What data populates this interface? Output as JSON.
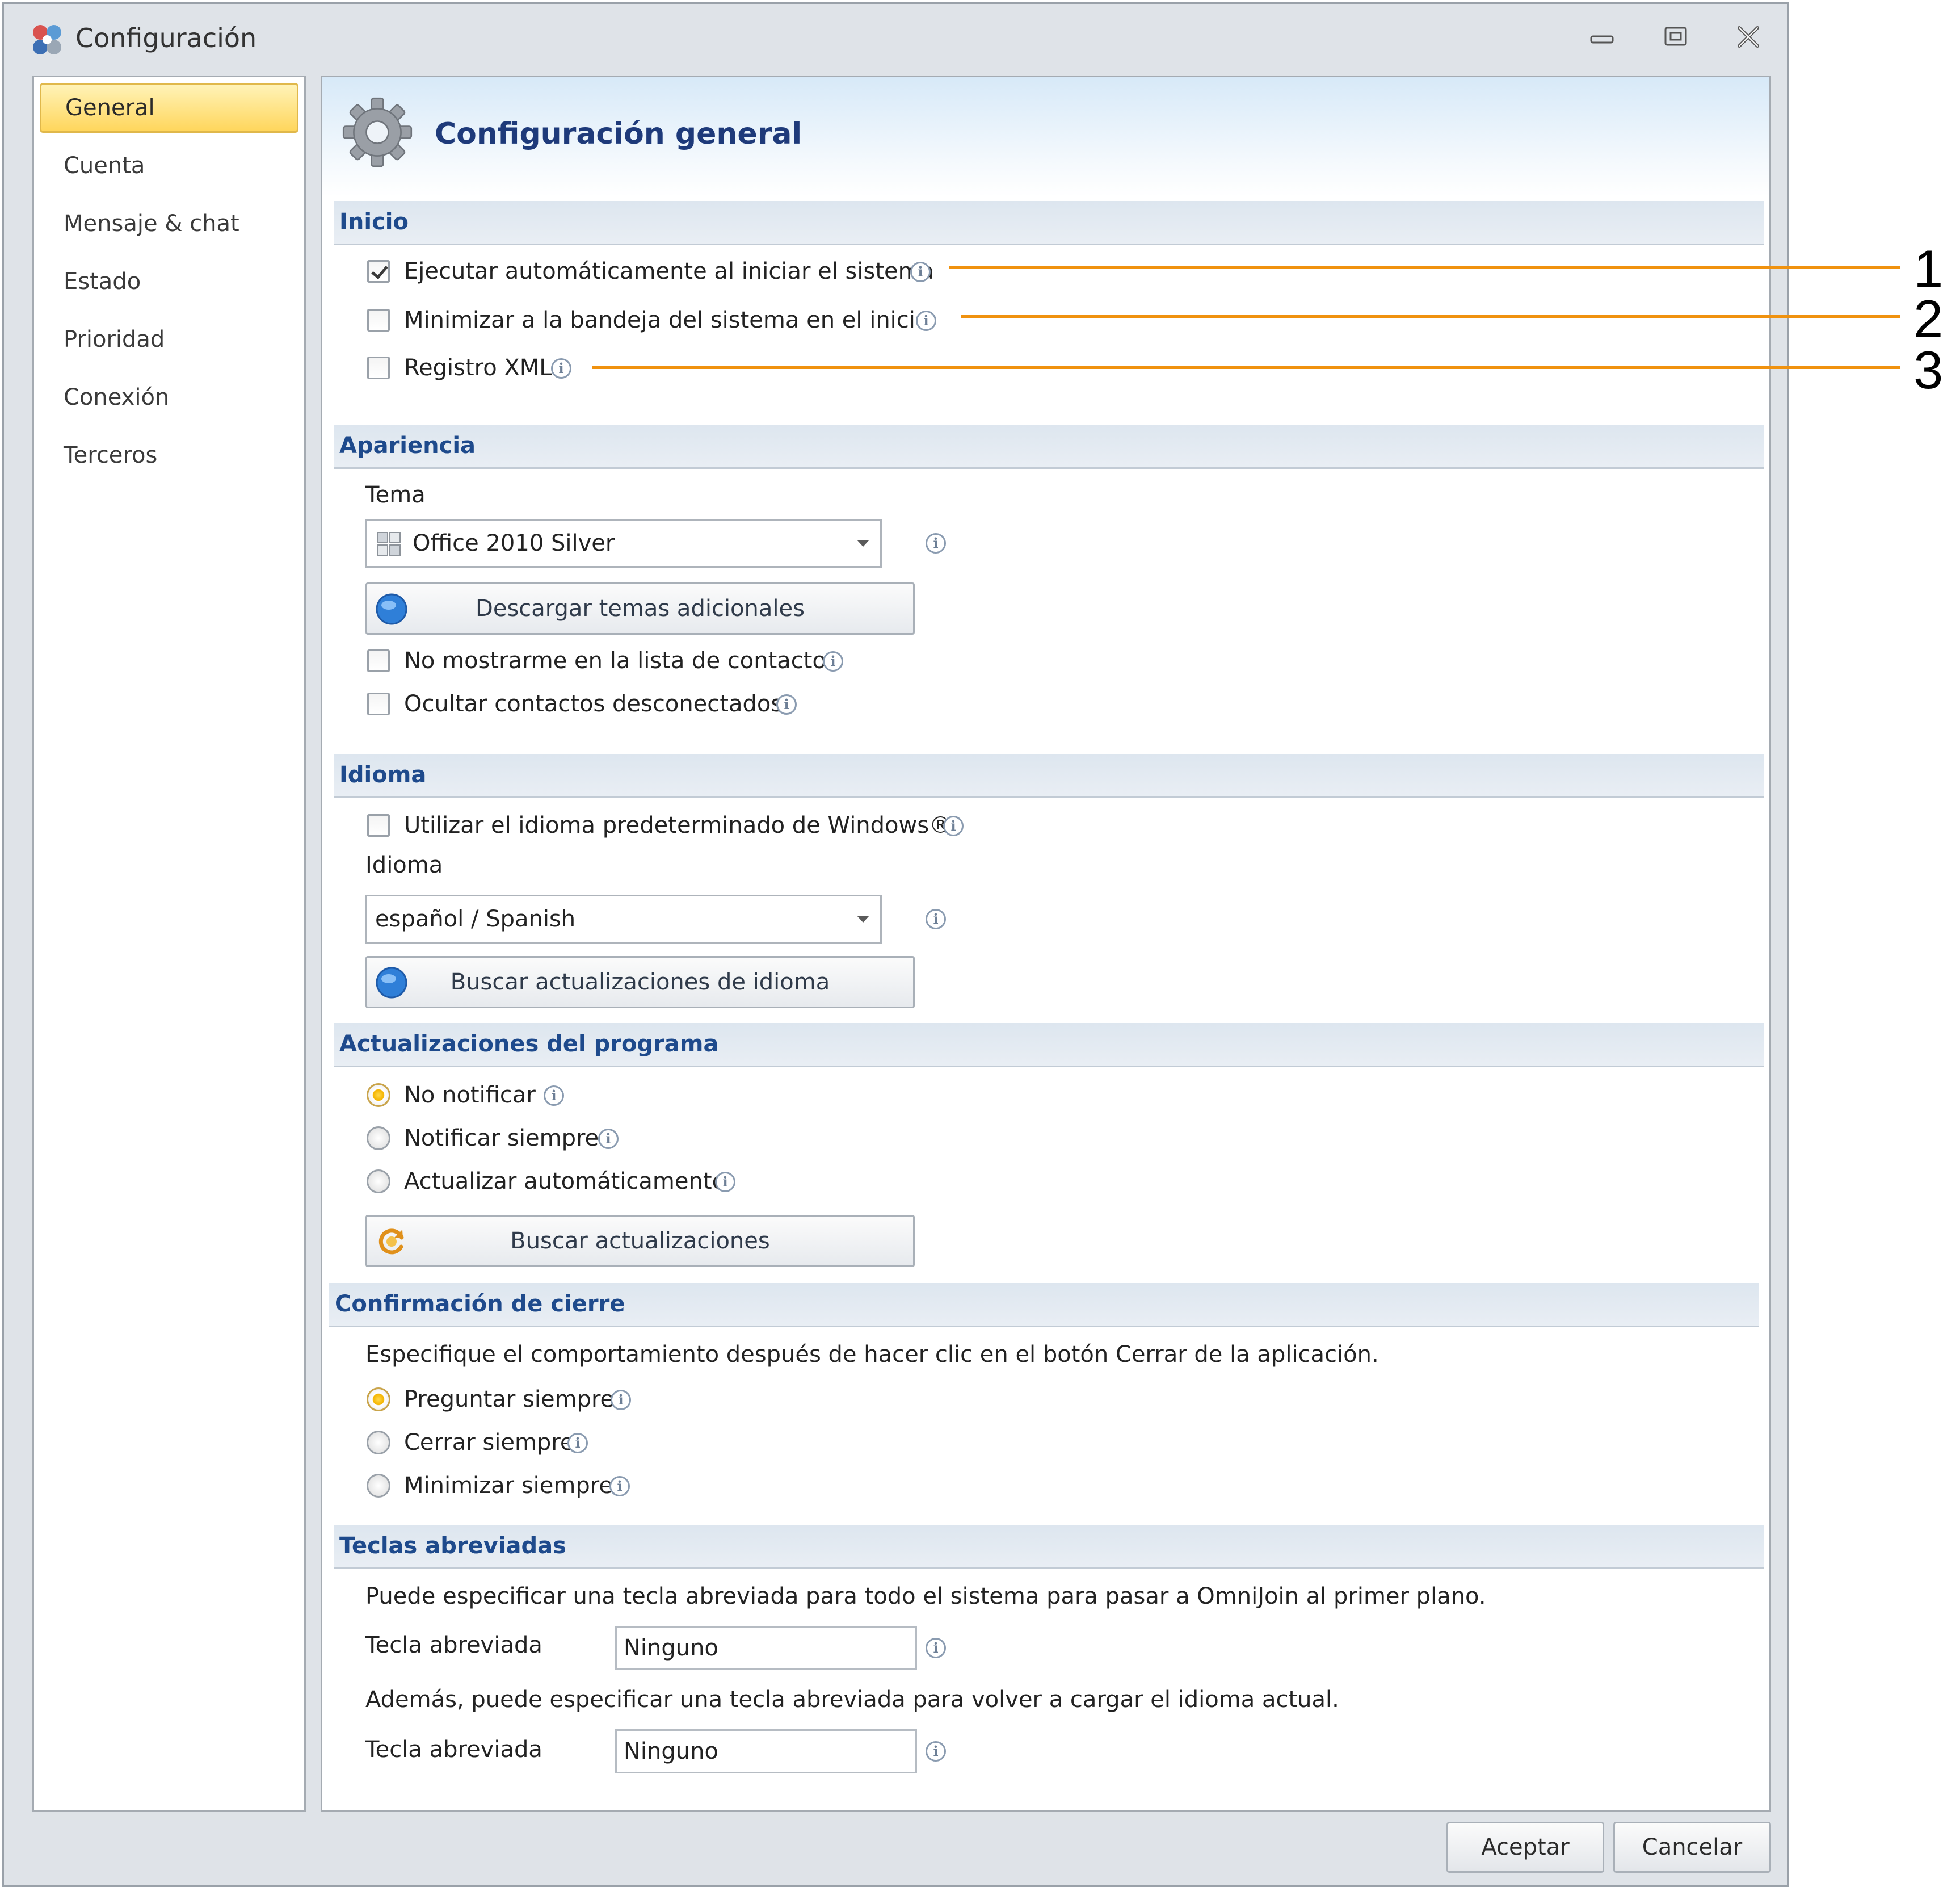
{
  "window": {
    "title": "Configuración",
    "controls": {
      "minimize": "minimize",
      "maximize": "maximize",
      "close": "close"
    }
  },
  "sidebar": {
    "items": [
      {
        "label": "General",
        "active": true
      },
      {
        "label": "Cuenta"
      },
      {
        "label": "Mensaje & chat"
      },
      {
        "label": "Estado"
      },
      {
        "label": "Prioridad"
      },
      {
        "label": "Conexión"
      },
      {
        "label": "Terceros"
      }
    ]
  },
  "page": {
    "title": "Configuración general"
  },
  "sections": {
    "inicio": {
      "title": "Inicio",
      "options": [
        {
          "label": "Ejecutar automáticamente al iniciar el sistema",
          "checked": true
        },
        {
          "label": "Minimizar a la bandeja del sistema en el inicio",
          "checked": false
        },
        {
          "label": "Registro XML",
          "checked": false
        }
      ]
    },
    "apariencia": {
      "title": "Apariencia",
      "theme_label": "Tema",
      "theme_value": "Office 2010 Silver",
      "download_button": "Descargar temas adicionales",
      "options": [
        {
          "label": "No mostrarme en la lista de contactos",
          "checked": false
        },
        {
          "label": "Ocultar contactos desconectados",
          "checked": false
        }
      ]
    },
    "idioma": {
      "title": "Idioma",
      "use_windows": {
        "label": "Utilizar el idioma predeterminado de Windows®",
        "checked": false
      },
      "language_label": "Idioma",
      "language_value": "español / Spanish",
      "update_button": "Buscar actualizaciones de idioma"
    },
    "actualizaciones": {
      "title": "Actualizaciones del programa",
      "options": [
        {
          "label": "No notificar",
          "selected": true
        },
        {
          "label": "Notificar siempre",
          "selected": false
        },
        {
          "label": "Actualizar automáticamente",
          "selected": false
        }
      ],
      "check_button": "Buscar actualizaciones"
    },
    "cierre": {
      "title": "Confirmación de cierre",
      "description": "Especifique el comportamiento después de hacer clic en el botón Cerrar de la aplicación.",
      "options": [
        {
          "label": "Preguntar siempre",
          "selected": true
        },
        {
          "label": "Cerrar siempre",
          "selected": false
        },
        {
          "label": "Minimizar siempre",
          "selected": false
        }
      ]
    },
    "teclas": {
      "title": "Teclas abreviadas",
      "description1": "Puede especificar una tecla abreviada para todo el sistema para pasar a OmniJoin al primer plano.",
      "hotkey1_label": "Tecla abreviada",
      "hotkey1_value": "Ninguno",
      "description2": "Además, puede especificar una tecla abreviada para volver a cargar el idioma actual.",
      "hotkey2_label": "Tecla abreviada",
      "hotkey2_value": "Ninguno"
    }
  },
  "footer": {
    "accept": "Aceptar",
    "cancel": "Cancelar"
  },
  "callouts": [
    "1",
    "2",
    "3"
  ],
  "colors": {
    "accent": "#f0920f",
    "section_title": "#1e4a8c",
    "active_nav": "#ffd65c"
  }
}
